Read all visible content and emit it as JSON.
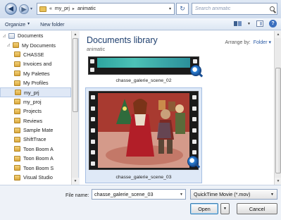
{
  "address": {
    "crumbs": [
      "«",
      "my_prj",
      "animatic"
    ]
  },
  "search": {
    "placeholder": "Search animatic"
  },
  "toolbar": {
    "organize": "Organize",
    "new_folder": "New folder"
  },
  "nav": {
    "items": [
      {
        "label": "Documents",
        "type": "lib",
        "expand": "◿"
      },
      {
        "label": "My Documents",
        "type": "folder",
        "expand": "◿"
      },
      {
        "label": "CHASSE",
        "type": "folder",
        "expand": ""
      },
      {
        "label": "Invoices and",
        "type": "folder",
        "expand": ""
      },
      {
        "label": "My Palettes",
        "type": "folder",
        "expand": ""
      },
      {
        "label": "My Profiles",
        "type": "folder",
        "expand": ""
      },
      {
        "label": "my_prj",
        "type": "folder",
        "expand": "",
        "selected": true
      },
      {
        "label": "my_proj",
        "type": "folder",
        "expand": ""
      },
      {
        "label": "Projects",
        "type": "folder",
        "expand": ""
      },
      {
        "label": "Reviews",
        "type": "folder",
        "expand": ""
      },
      {
        "label": "Sample Mate",
        "type": "folder",
        "expand": ""
      },
      {
        "label": "ShiftTrace",
        "type": "folder",
        "expand": ""
      },
      {
        "label": "Toon Boom A",
        "type": "folder",
        "expand": ""
      },
      {
        "label": "Toon Boom A",
        "type": "folder",
        "expand": ""
      },
      {
        "label": "Toon Boom S",
        "type": "folder",
        "expand": ""
      },
      {
        "label": "Visual Studio",
        "type": "folder",
        "expand": ""
      }
    ]
  },
  "content": {
    "title": "Documents library",
    "subtitle": "animatic",
    "arrange_label": "Arrange by:",
    "arrange_value": "Folder",
    "files": [
      {
        "name": "chasse_galerie_scene_02"
      },
      {
        "name": "chasse_galerie_scene_03"
      }
    ]
  },
  "bottom": {
    "file_name_label": "File name:",
    "file_name_value": "chasse_galerie_scene_03",
    "file_type": "QuickTime Movie (*.mov)",
    "open": "Open",
    "cancel": "Cancel"
  },
  "colors": {
    "accent": "#1e3f6e",
    "selection": "#dfe9f7",
    "link": "#2a5aa5"
  }
}
